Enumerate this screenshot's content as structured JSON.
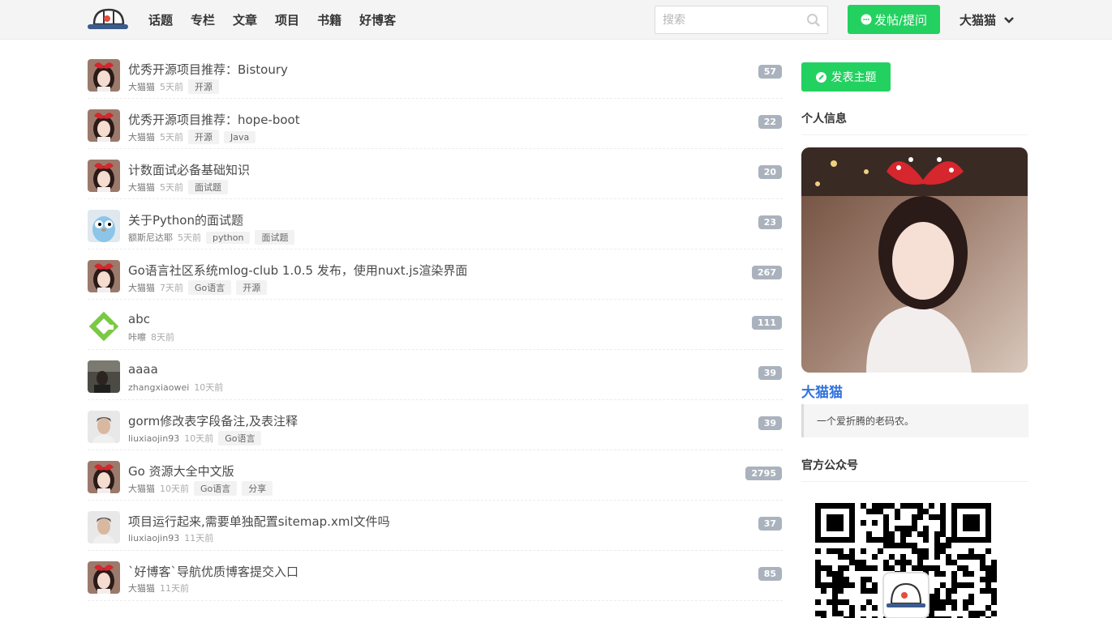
{
  "nav": {
    "links": [
      "话题",
      "专栏",
      "文章",
      "项目",
      "书籍",
      "好博客"
    ],
    "search_placeholder": "搜索",
    "post_button": "发帖/提问",
    "user": "大猫猫"
  },
  "topics": [
    {
      "avatar": "cat-girl",
      "title": "优秀开源项目推荐：Bistoury",
      "author": "大猫猫",
      "time": "5天前",
      "tags": [
        "开源"
      ],
      "count": "57"
    },
    {
      "avatar": "cat-girl",
      "title": "优秀开源项目推荐：hope-boot",
      "author": "大猫猫",
      "time": "5天前",
      "tags": [
        "开源",
        "Java"
      ],
      "count": "22"
    },
    {
      "avatar": "cat-girl",
      "title": "计数面试必备基础知识",
      "author": "大猫猫",
      "time": "5天前",
      "tags": [
        "面试题"
      ],
      "count": "20"
    },
    {
      "avatar": "gopher",
      "title": "关于Python的面试题",
      "author": "额斯尼达耶",
      "time": "5天前",
      "tags": [
        "python",
        "面试题"
      ],
      "count": "23"
    },
    {
      "avatar": "cat-girl",
      "title": "Go语言社区系统mlog-club 1.0.5 发布，使用nuxt.js渲染界面",
      "author": "大猫猫",
      "time": "7天前",
      "tags": [
        "Go语言",
        "开源"
      ],
      "count": "267"
    },
    {
      "avatar": "green-logo",
      "title": "abc",
      "author": "咔嚓",
      "time": "8天前",
      "tags": [],
      "count": "111"
    },
    {
      "avatar": "dark-photo",
      "title": "aaaa",
      "author": "zhangxiaowei",
      "time": "10天前",
      "tags": [],
      "count": "39"
    },
    {
      "avatar": "man-photo",
      "title": "gorm修改表字段备注,及表注释",
      "author": "liuxiaojin93",
      "time": "10天前",
      "tags": [
        "Go语言"
      ],
      "count": "39"
    },
    {
      "avatar": "cat-girl",
      "title": "Go 资源大全中文版",
      "author": "大猫猫",
      "time": "10天前",
      "tags": [
        "Go语言",
        "分享"
      ],
      "count": "2795"
    },
    {
      "avatar": "man-photo",
      "title": "项目运行起来,需要单独配置sitemap.xml文件吗",
      "author": "liuxiaojin93",
      "time": "11天前",
      "tags": [],
      "count": "37"
    },
    {
      "avatar": "cat-girl",
      "title": "`好博客`导航优质博客提交入口",
      "author": "大猫猫",
      "time": "11天前",
      "tags": [],
      "count": "85"
    }
  ],
  "sidebar": {
    "new_topic": "发表主题",
    "profile_heading": "个人信息",
    "username": "大猫猫",
    "bio": "一个爱折腾的老码农。",
    "wechat_heading": "官方公众号"
  },
  "colors": {
    "accent_green": "#23d160",
    "link_blue": "#3273dc",
    "badge_gray": "#aab2bd"
  }
}
